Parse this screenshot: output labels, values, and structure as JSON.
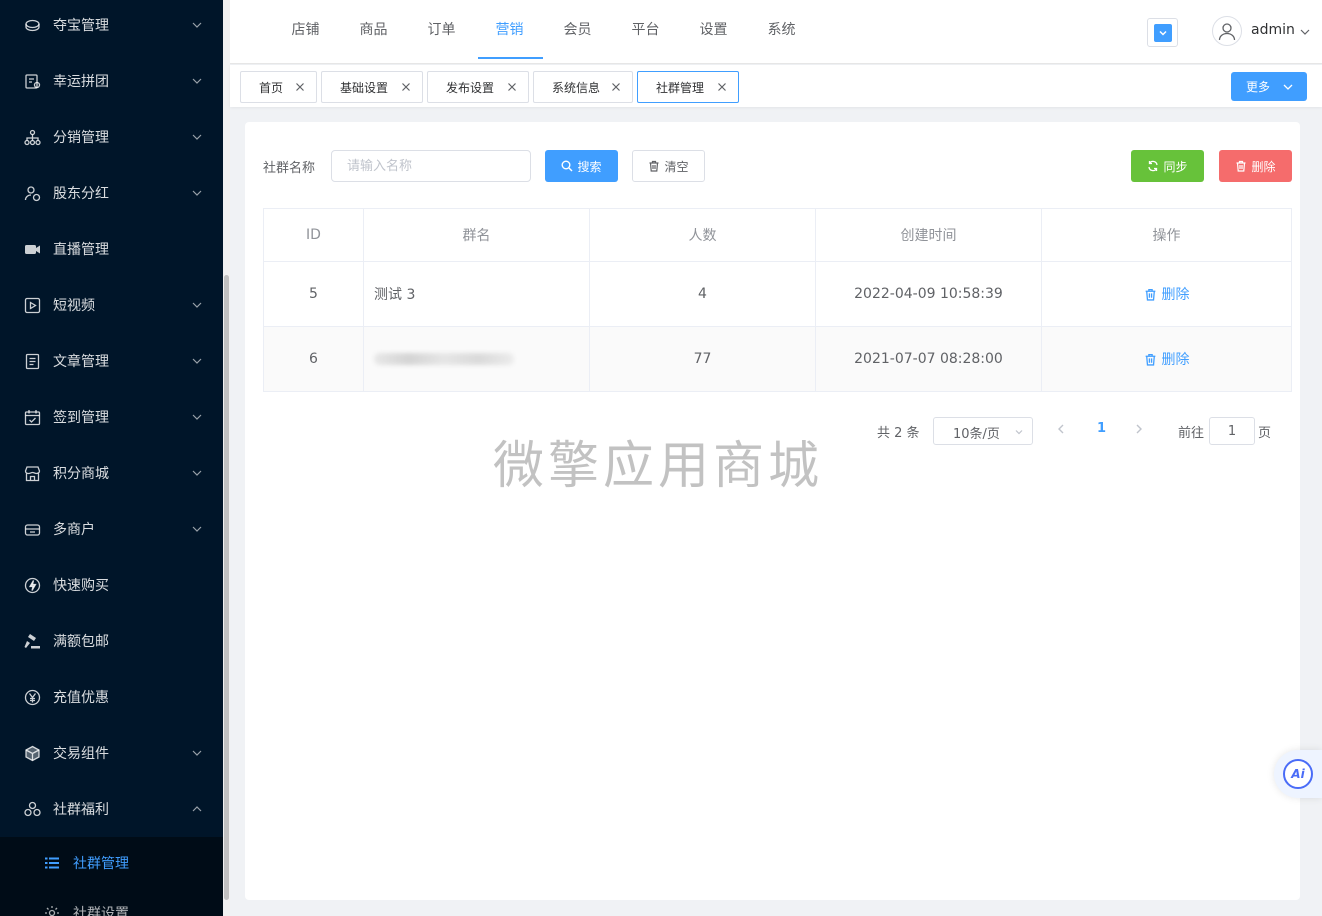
{
  "sidebar": {
    "items": [
      {
        "label": "夺宝管理",
        "icon": "treasure-icon",
        "expandable": true
      },
      {
        "label": "幸运拼团",
        "icon": "group-buy-icon",
        "expandable": true
      },
      {
        "label": "分销管理",
        "icon": "distribution-icon",
        "expandable": true
      },
      {
        "label": "股东分红",
        "icon": "shareholder-icon",
        "expandable": true
      },
      {
        "label": "直播管理",
        "icon": "live-camera-icon",
        "expandable": false
      },
      {
        "label": "短视频",
        "icon": "video-icon",
        "expandable": true
      },
      {
        "label": "文章管理",
        "icon": "article-icon",
        "expandable": true
      },
      {
        "label": "签到管理",
        "icon": "calendar-check-icon",
        "expandable": true
      },
      {
        "label": "积分商城",
        "icon": "store-icon",
        "expandable": true
      },
      {
        "label": "多商户",
        "icon": "merchant-icon",
        "expandable": true
      },
      {
        "label": "快速购买",
        "icon": "lightning-icon",
        "expandable": false
      },
      {
        "label": "满额包邮",
        "icon": "shipping-icon",
        "expandable": false
      },
      {
        "label": "充值优惠",
        "icon": "yen-icon",
        "expandable": false
      },
      {
        "label": "交易组件",
        "icon": "cube-icon",
        "expandable": true
      },
      {
        "label": "社群福利",
        "icon": "community-icon",
        "expandable": true,
        "expanded": true
      }
    ],
    "sub_items": [
      {
        "label": "社群管理",
        "icon": "list-icon",
        "active": true
      },
      {
        "label": "社群设置",
        "icon": "gear-icon",
        "active": false
      }
    ]
  },
  "topnav": {
    "tabs": [
      "店铺",
      "商品",
      "订单",
      "营销",
      "会员",
      "平台",
      "设置",
      "系统"
    ],
    "active_tab": "营销",
    "username": "admin"
  },
  "tags": {
    "items": [
      "首页",
      "基础设置",
      "发布设置",
      "系统信息",
      "社群管理"
    ],
    "active": "社群管理",
    "more_label": "更多"
  },
  "search": {
    "label": "社群名称",
    "placeholder": "请输入名称",
    "search_button": "搜索",
    "clear_button": "清空",
    "sync_button": "同步",
    "delete_button": "删除"
  },
  "table": {
    "headers": [
      "ID",
      "群名",
      "人数",
      "创建时间",
      "操作"
    ],
    "rows": [
      {
        "id": "5",
        "name": "测试 3",
        "count": "4",
        "created": "2022-04-09 10:58:39",
        "action": "删除"
      },
      {
        "id": "6",
        "name": "",
        "count": "77",
        "created": "2021-07-07 08:28:00",
        "action": "删除"
      }
    ]
  },
  "pagination": {
    "total": "共 2 条",
    "page_size": "10条/页",
    "current_page": "1",
    "goto_label": "前往",
    "goto_value": "1",
    "page_suffix": "页"
  },
  "watermark": "微擎应用商城",
  "ai_badge": "Ai",
  "colors": {
    "sidebar_bg": "#001529",
    "primary": "#409eff",
    "success": "#67c23a",
    "danger": "#f56c6c"
  }
}
